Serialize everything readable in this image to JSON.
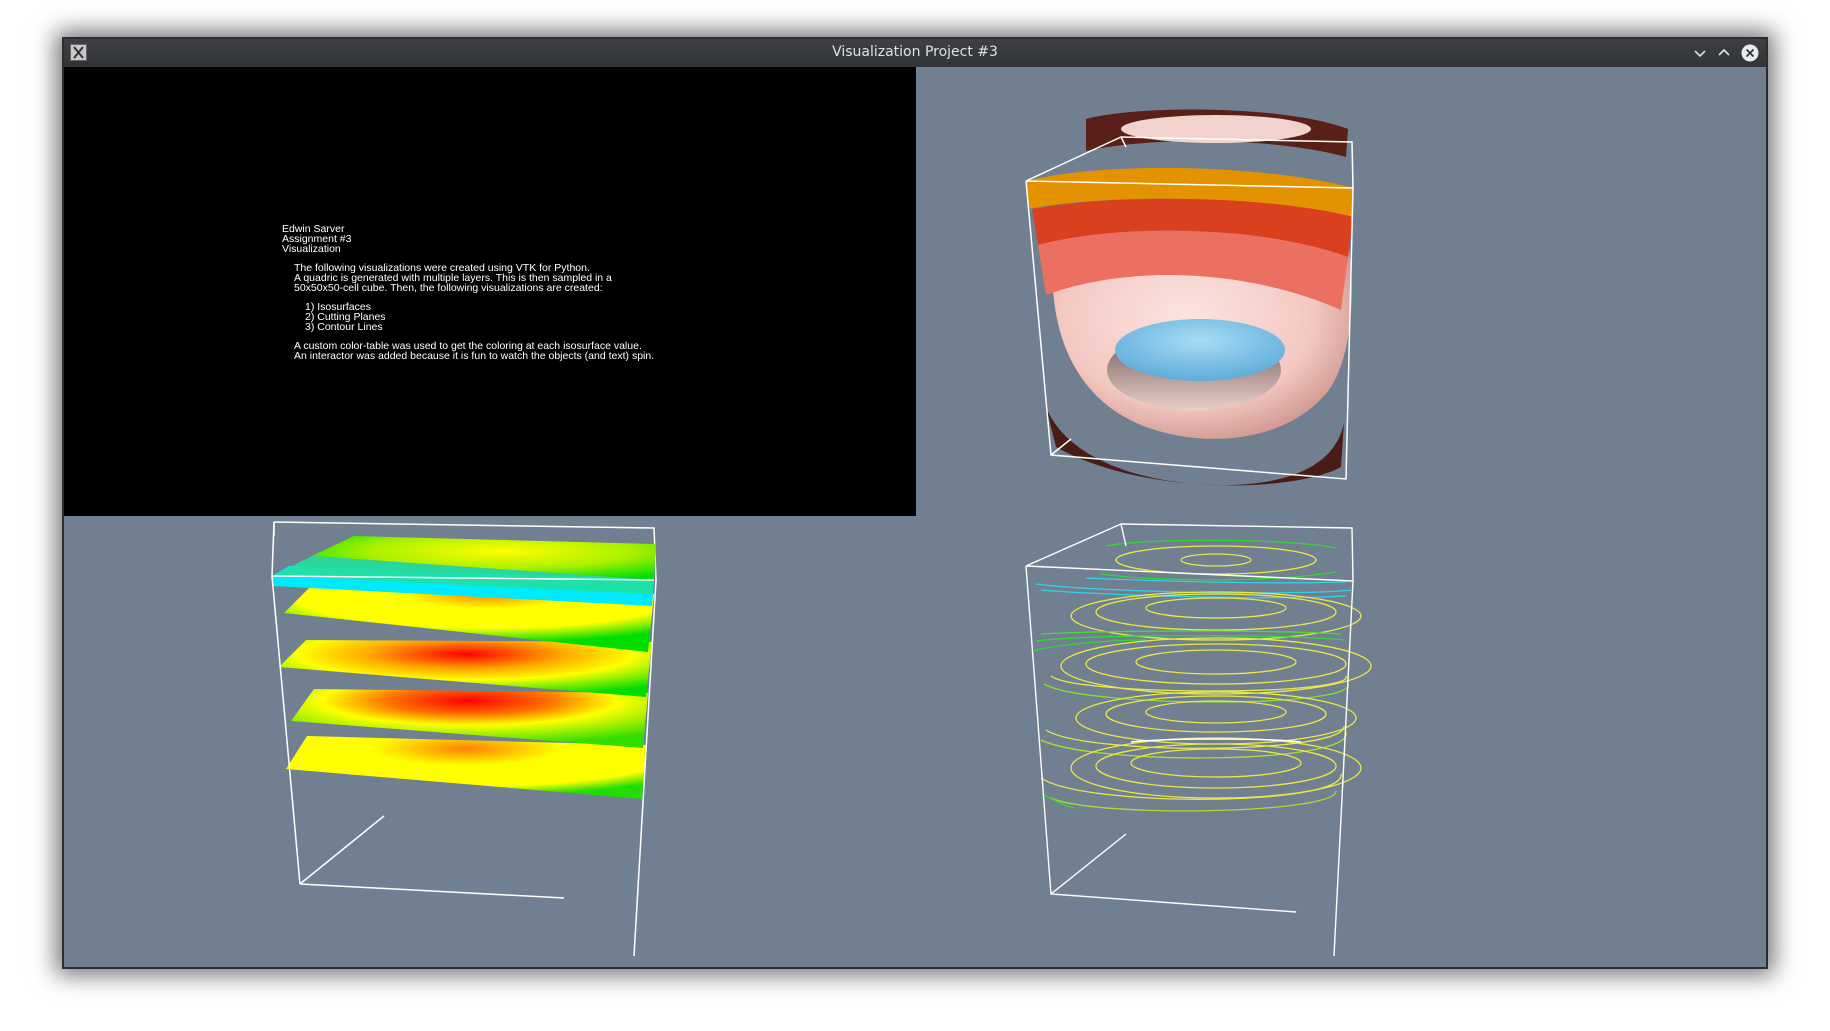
{
  "window": {
    "title": "Visualization Project #3",
    "background": "#708090"
  },
  "text_panel": {
    "author": "Edwin Sarver",
    "assignment": "Assignment #3",
    "subject": "Visualization",
    "intro": [
      "The following visualizations were created using VTK for Python.",
      "A quadric is generated with multiple layers. This is then sampled in a",
      "50x50x50-cell cube. Then, the following visualizations are created:"
    ],
    "items": [
      "1) Isosurfaces",
      "2) Cutting Planes",
      "3) Contour Lines"
    ],
    "outro": [
      "A custom color-table was used to get the coloring at each isosurface value.",
      "An interactor was added because it is fun to watch the objects (and text) spin."
    ]
  },
  "views": {
    "isosurfaces": {
      "colors": [
        "#e8a000",
        "#de4a22",
        "#ef7a6a",
        "#f6d3ce",
        "#8ccbee"
      ]
    },
    "cutting_planes": {
      "colors": [
        "#00e6ff",
        "#00dd00",
        "#ffff00",
        "#ff0000"
      ]
    },
    "contour_lines": {
      "colors": [
        "#00e6ff",
        "#33d633",
        "#e8e84a"
      ]
    }
  },
  "icons": [
    "x-window-icon",
    "minimize-icon",
    "maximize-icon",
    "close-icon"
  ]
}
